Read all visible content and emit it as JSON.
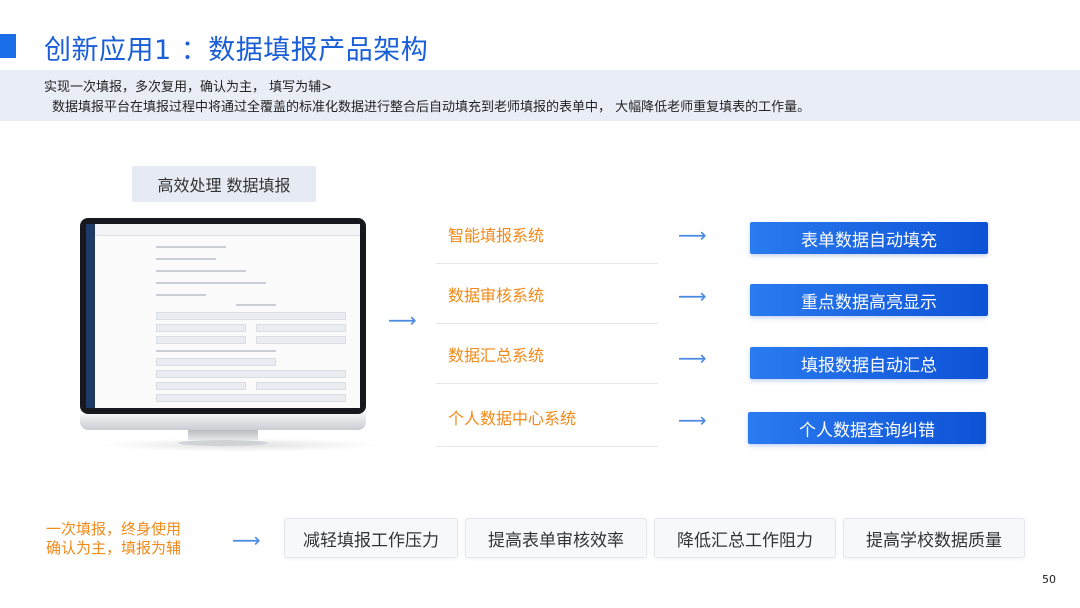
{
  "title": "创新应用1 ：数据填报产品架构",
  "intro": {
    "line1": "实现一次填报，多次复用，确认为主， 填写为辅>",
    "line2": "数据填报平台在填报过程中将通过全覆盖的标准化数据进行整合后自动填充到老师填报的表单中， 大幅降低老师重复填表的工作量。"
  },
  "label_box": "高效处理 数据填报",
  "systems": [
    {
      "name": "智能填报系统",
      "result": "表单数据自动填充"
    },
    {
      "name": "数据审核系统",
      "result": "重点数据高亮显示"
    },
    {
      "name": "数据汇总系统",
      "result": "填报数据自动汇总"
    },
    {
      "name": "个人数据中心系统",
      "result": "个人数据查询纠错"
    }
  ],
  "slogan": {
    "line1": "一次填报，终身使用",
    "line2": "确认为主，填报为辅"
  },
  "benefits": [
    "减轻填报工作压力",
    "提高表单审核效率",
    "降低汇总工作阻力",
    "提高学校数据质量"
  ],
  "page_number": "50",
  "colors": {
    "accent_blue": "#1a5fd8",
    "orange": "#f08a1a",
    "intro_bg": "#e8edf6"
  },
  "icons": {
    "arrow": "right-arrow-icon"
  }
}
